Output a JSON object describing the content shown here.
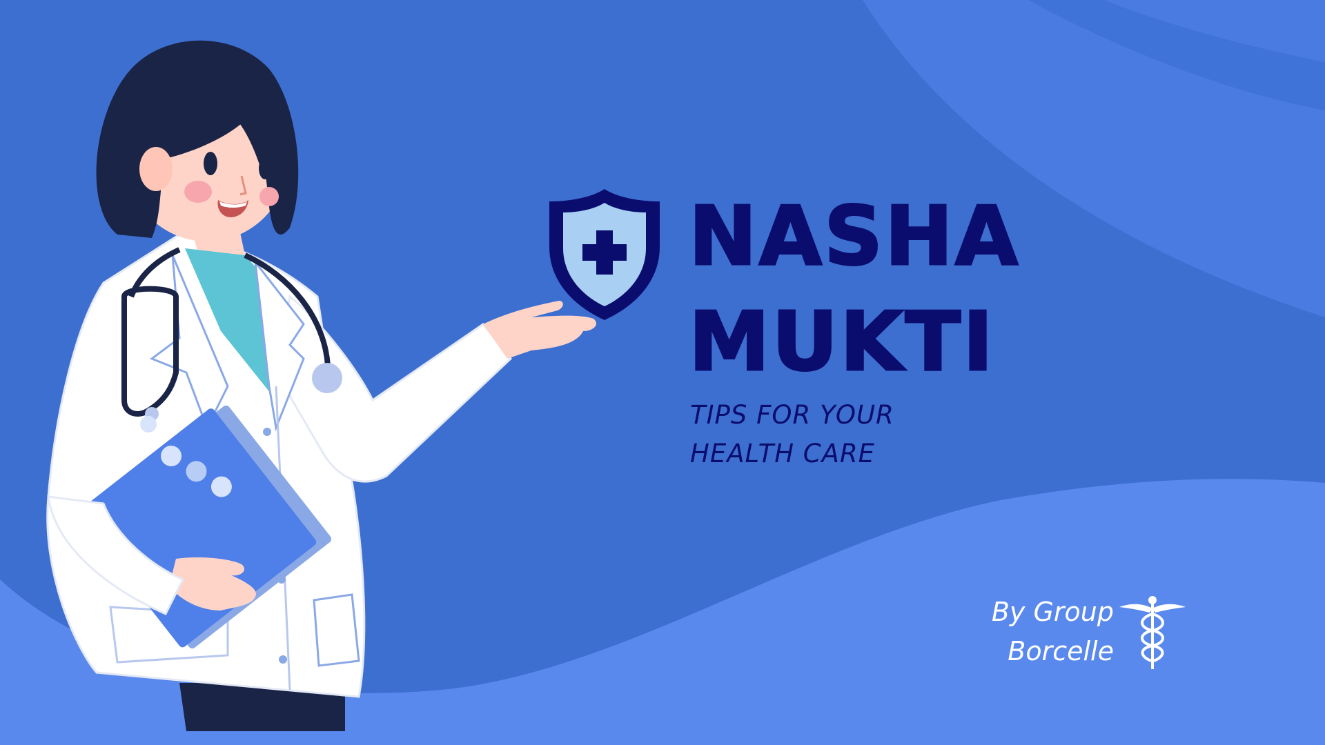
{
  "title": {
    "line1": "NASHA",
    "line2": "MUKTI"
  },
  "subtitle": {
    "line1": "TIPS FOR YOUR",
    "line2": "HEALTH CARE"
  },
  "byline": {
    "line1": "By Group",
    "line2": "Borcelle"
  },
  "colors": {
    "background": "#3d6fd1",
    "wave_light": "#5a89ee",
    "title": "#0b0d6e",
    "byline": "#ffffff",
    "shield_fill": "#a9cff3"
  },
  "icons": [
    "shield-plus-icon",
    "caduceus-icon"
  ]
}
